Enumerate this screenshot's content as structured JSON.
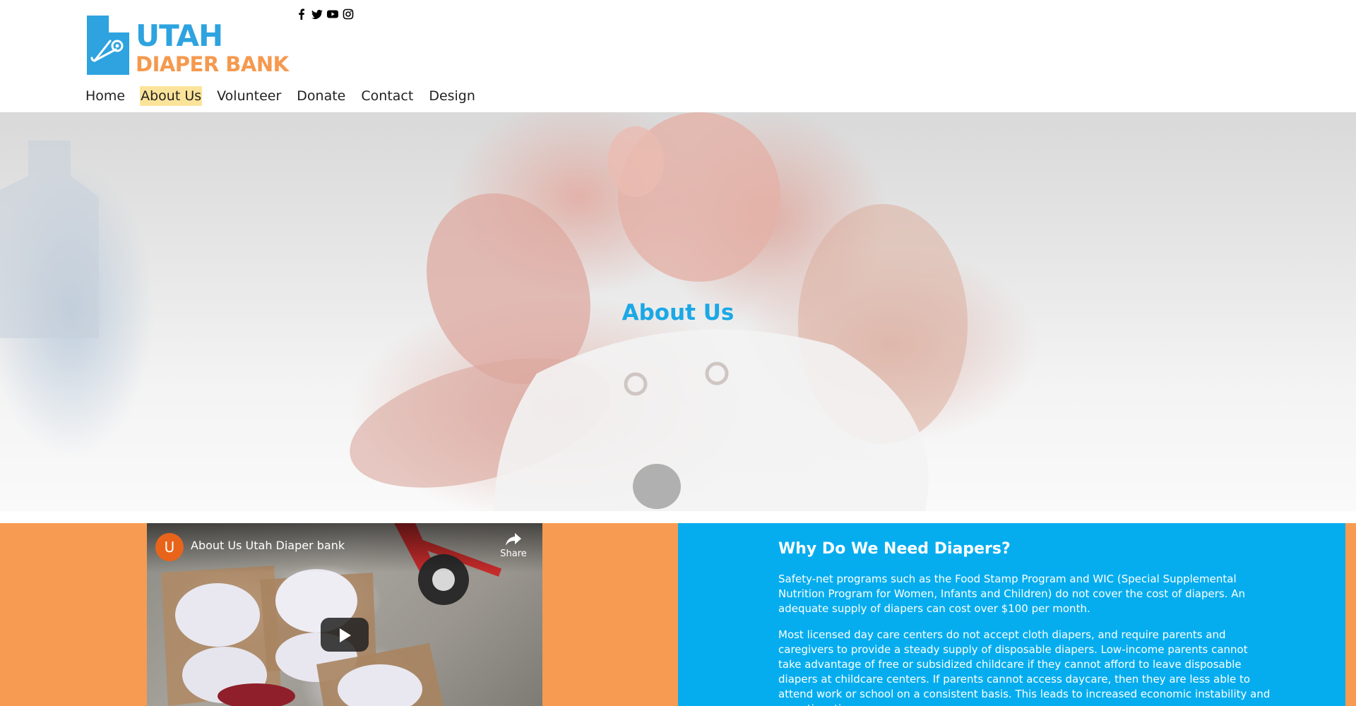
{
  "header": {
    "logo": {
      "line1": "UTAH",
      "line2": "DIAPER BANK",
      "icon": "safety-pin-utah-icon"
    },
    "social": [
      {
        "name": "facebook",
        "icon": "facebook-icon"
      },
      {
        "name": "twitter",
        "icon": "twitter-icon"
      },
      {
        "name": "youtube",
        "icon": "youtube-icon"
      },
      {
        "name": "instagram",
        "icon": "instagram-icon"
      }
    ],
    "nav": [
      {
        "label": "Home",
        "active": false
      },
      {
        "label": "About Us",
        "active": true
      },
      {
        "label": "Volunteer",
        "active": false
      },
      {
        "label": "Donate",
        "active": false
      },
      {
        "label": "Contact",
        "active": false
      },
      {
        "label": "Design",
        "active": false
      }
    ]
  },
  "hero": {
    "title": "About Us"
  },
  "video": {
    "channel_initial": "U",
    "title": "About Us Utah Diaper bank",
    "share_label": "Share"
  },
  "why": {
    "heading": "Why Do We Need Diapers?",
    "paragraphs": [
      "Safety-net programs such as the Food Stamp Program and WIC (Special Supplemental Nutrition Program for Women, Infants and Children) do not cover the cost of diapers. An adequate supply of diapers can cost over $100 per month.",
      "Most licensed day care centers do not accept cloth diapers, and require parents and caregivers to provide a steady supply of disposable diapers. Low-income parents cannot take advantage of free or subsidized childcare if they cannot afford to leave disposable diapers at childcare centers. If parents cannot access daycare, then they are less able to attend work or school on a consistent basis. This leads to increased economic instability and a continuation"
    ]
  },
  "colors": {
    "brand_blue": "#2ea3e0",
    "brand_orange": "#f5994e",
    "nav_highlight": "#fbe49a",
    "section_orange": "#f79b52",
    "section_blue": "#05adef",
    "hero_title": "#1ba8e6"
  }
}
